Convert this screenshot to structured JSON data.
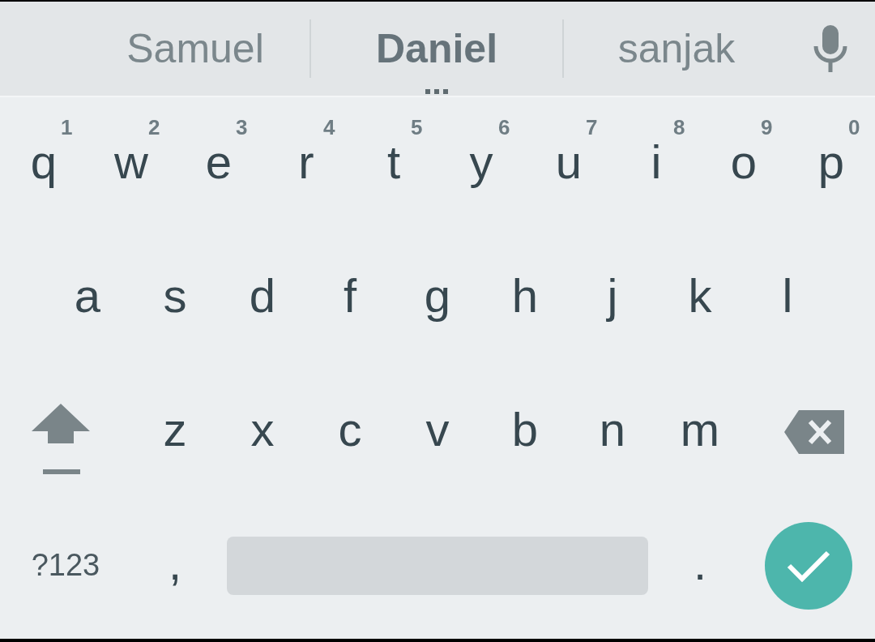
{
  "suggestions": [
    {
      "text": "Samuel",
      "selected": false
    },
    {
      "text": "Daniel",
      "selected": true
    },
    {
      "text": "sanjak",
      "selected": false
    }
  ],
  "rows": [
    [
      {
        "kind": "letter",
        "label": "q",
        "hint": "1"
      },
      {
        "kind": "letter",
        "label": "w",
        "hint": "2"
      },
      {
        "kind": "letter",
        "label": "e",
        "hint": "3"
      },
      {
        "kind": "letter",
        "label": "r",
        "hint": "4"
      },
      {
        "kind": "letter",
        "label": "t",
        "hint": "5"
      },
      {
        "kind": "letter",
        "label": "y",
        "hint": "6"
      },
      {
        "kind": "letter",
        "label": "u",
        "hint": "7"
      },
      {
        "kind": "letter",
        "label": "i",
        "hint": "8"
      },
      {
        "kind": "letter",
        "label": "o",
        "hint": "9"
      },
      {
        "kind": "letter",
        "label": "p",
        "hint": "0"
      }
    ],
    [
      {
        "kind": "letter",
        "label": "a"
      },
      {
        "kind": "letter",
        "label": "s"
      },
      {
        "kind": "letter",
        "label": "d"
      },
      {
        "kind": "letter",
        "label": "f"
      },
      {
        "kind": "letter",
        "label": "g"
      },
      {
        "kind": "letter",
        "label": "h"
      },
      {
        "kind": "letter",
        "label": "j"
      },
      {
        "kind": "letter",
        "label": "k"
      },
      {
        "kind": "letter",
        "label": "l"
      }
    ],
    [
      {
        "kind": "shift"
      },
      {
        "kind": "letter",
        "label": "z"
      },
      {
        "kind": "letter",
        "label": "x"
      },
      {
        "kind": "letter",
        "label": "c"
      },
      {
        "kind": "letter",
        "label": "v"
      },
      {
        "kind": "letter",
        "label": "b"
      },
      {
        "kind": "letter",
        "label": "n"
      },
      {
        "kind": "letter",
        "label": "m"
      },
      {
        "kind": "delete"
      }
    ],
    [
      {
        "kind": "symbols",
        "label": "?123"
      },
      {
        "kind": "letter",
        "label": ","
      },
      {
        "kind": "space"
      },
      {
        "kind": "letter",
        "label": "."
      },
      {
        "kind": "enter"
      }
    ]
  ]
}
